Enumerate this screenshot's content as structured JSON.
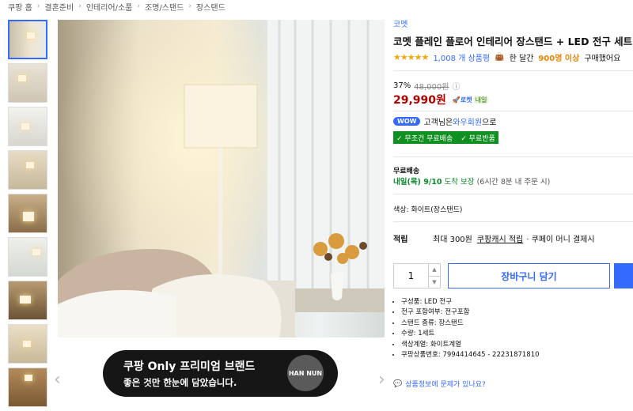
{
  "breadcrumb": [
    "쿠팡 홈",
    "결혼준비",
    "인테리어/소품",
    "조명/스탠드",
    "장스탠드"
  ],
  "product": {
    "brand": "코멧",
    "title": "코멧 플레인 플로어 인테리어 장스탠드 + LED 전구 세트",
    "rating_stars": "★★★★★",
    "review_count": "1,008 개 상품평",
    "purchase_prefix": "한 달간",
    "purchase_count": "900명 이상",
    "purchase_suffix": "구매했어요"
  },
  "price": {
    "discount": "37%",
    "original": "48,000원",
    "info_icon": "ⓘ",
    "sale": "29,990원",
    "rocket_label": "로켓",
    "rocket_tag": "내일"
  },
  "wow": {
    "badge": "WOW",
    "text_prefix": "고객님은",
    "member": "와우회원",
    "text_suffix": "으로"
  },
  "shipping": {
    "free_shipping": "무조건 무료배송",
    "free_return": "무료반품",
    "title": "무료배송",
    "date": "내일(목) 9/10",
    "guarantee": "도착 보장",
    "note": "(6시간 8분 내 주문 시)"
  },
  "option": {
    "color": "색상: 화이트(장스탠드)"
  },
  "points": {
    "label": "적립",
    "max": "최대 300원",
    "link": "쿠팡캐시 적립",
    "note": "· 쿠페이 머니 결제시"
  },
  "quantity": "1",
  "buttons": {
    "cart": "장바구니 담기"
  },
  "specs": [
    "구성품: LED 전구",
    "전구 포함여부: 전구포함",
    "스탠드 종류: 장스탠드",
    "수량: 1세트",
    "색상계열: 화이트계열",
    "쿠팡상품번호: 7994414645 - 22231871810"
  ],
  "report_link": "상품정보에 문제가 있나요?",
  "banner": {
    "line1": "쿠팡 Only 프리미엄 브랜드",
    "line2": "좋은 것만 한눈에 담았습니다.",
    "logo_text": "HAN NUN"
  },
  "icons": {
    "prev": "‹",
    "next": "›",
    "check": "✓",
    "rocket": "🚀",
    "chat": "💬",
    "bag": "👜"
  },
  "colors": {
    "accent": "#346aff",
    "price_red": "#ae0000",
    "ship_green": "#109020",
    "highlight_orange": "#e5850a"
  }
}
